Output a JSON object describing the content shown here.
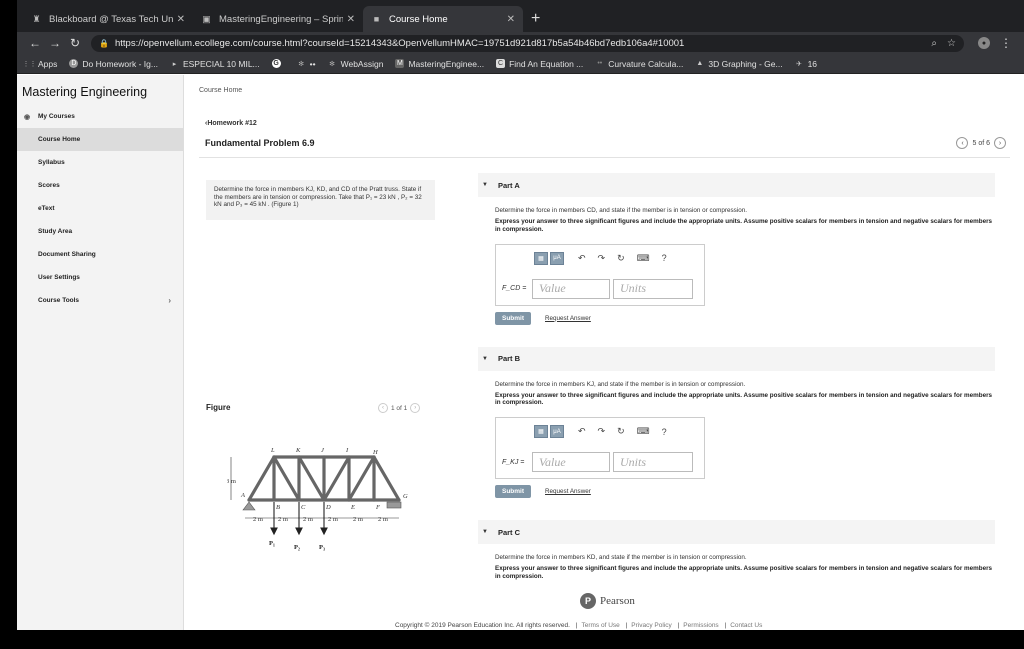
{
  "browser": {
    "tabs": [
      {
        "label": "Blackboard @ Texas Tech Univ",
        "icon": "blackboard-icon"
      },
      {
        "label": "MasteringEngineering – Spring",
        "icon": "mastering-icon"
      },
      {
        "label": "Course Home",
        "icon": "page-icon"
      }
    ],
    "url": "https://openvellum.ecollege.com/course.html?courseId=15214343&OpenVellumHMAC=19751d921d817b5a54b46bd7edb106a4#10001",
    "bookmarks": [
      {
        "label": "Apps",
        "icon": "apps-grid-icon"
      },
      {
        "label": "Do Homework - Ig...",
        "icon": "homework-icon"
      },
      {
        "label": "ESPECIAL 10 MIL...",
        "icon": "play-icon"
      },
      {
        "label": "",
        "icon": "google-icon"
      },
      {
        "label": "••",
        "icon": "pinwheel-icon"
      },
      {
        "label": "WebAssign",
        "icon": "webassign-icon"
      },
      {
        "label": "MasteringEnginee...",
        "icon": "mastering-icon"
      },
      {
        "label": "Find An Equation ...",
        "icon": "equation-icon"
      },
      {
        "label": "Curvature Calcula...",
        "icon": "calculator-icon"
      },
      {
        "label": "3D Graphing - Ge...",
        "icon": "geogebra-icon"
      },
      {
        "label": "16",
        "icon": "bird-icon"
      }
    ]
  },
  "sidebar": {
    "title": "Mastering Engineering",
    "items": [
      {
        "label": "My Courses"
      },
      {
        "label": "Course Home"
      },
      {
        "label": "Syllabus"
      },
      {
        "label": "Scores"
      },
      {
        "label": "eText"
      },
      {
        "label": "Study Area"
      },
      {
        "label": "Document Sharing"
      },
      {
        "label": "User Settings"
      },
      {
        "label": "Course Tools"
      }
    ]
  },
  "main": {
    "breadcrumb": "Course Home",
    "homework_link": "Homework #12",
    "problem_title": "Fundamental Problem 6.9",
    "pager": "5 of 6",
    "problem_text": "Determine the force in members KJ, KD, and CD of the Pratt truss. State if the members are in tension or compression. Take that P₁ = 23 kN , P₂ = 32 kN and P₃ = 45 kN . (Figure 1)",
    "figure_label": "Figure",
    "figure_pager": "1 of 1",
    "figure": {
      "top_nodes": [
        "L",
        "K",
        "J",
        "I",
        "H"
      ],
      "bottom_nodes": [
        "A",
        "B",
        "C",
        "D",
        "E",
        "F",
        "G"
      ],
      "height_label": "3 m",
      "spacing_label": "2 m",
      "loads": [
        "P₁",
        "P₂",
        "P₃"
      ]
    },
    "parts": [
      {
        "header": "Part A",
        "instruction": "Determine the force in members CD, and state if the member is in tension or compression.",
        "express": "Express your answer to three significant figures and include the appropriate units. Assume positive scalars for members in tension and negative scalars for members in compression.",
        "field_label": "F_CD =",
        "value_placeholder": "Value",
        "units_placeholder": "Units",
        "submit": "Submit",
        "request": "Request Answer"
      },
      {
        "header": "Part B",
        "instruction": "Determine the force in members KJ, and state if the member is in tension or compression.",
        "express": "Express your answer to three significant figures and include the appropriate units. Assume positive scalars for members in tension and negative scalars for members in compression.",
        "field_label": "F_KJ =",
        "value_placeholder": "Value",
        "units_placeholder": "Units",
        "submit": "Submit",
        "request": "Request Answer"
      },
      {
        "header": "Part C",
        "instruction": "Determine the force in members KD, and state if the member is in tension or compression.",
        "express": "Express your answer to three significant figures and include the appropriate units. Assume positive scalars for members in tension and negative scalars for members in compression."
      }
    ],
    "tool_labels": {
      "mu": "μA",
      "help": "?"
    }
  },
  "footer": {
    "brand": "Pearson",
    "copyright": "Copyright © 2019 Pearson Education Inc. All rights reserved.",
    "links": [
      "Terms of Use",
      "Privacy Policy",
      "Permissions",
      "Contact Us"
    ]
  }
}
